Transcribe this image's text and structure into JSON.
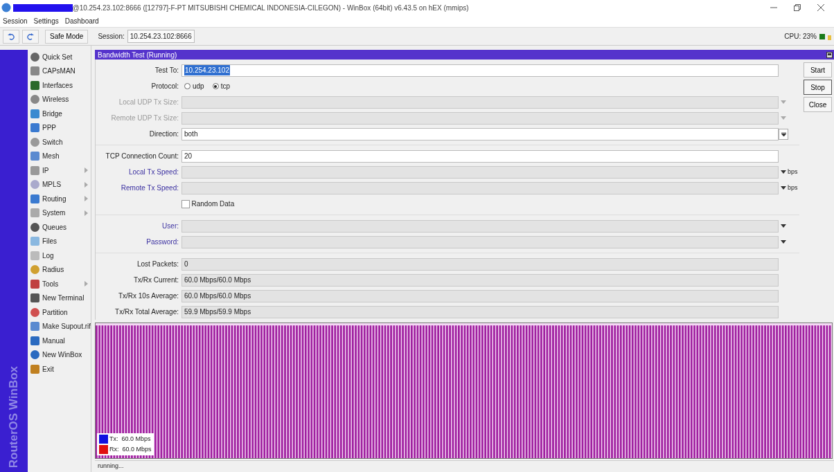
{
  "window": {
    "title": "@10.254.23.102:8666 ([12797]-F-PT MITSUBISHI CHEMICAL INDONESIA-CILEGON) - WinBox (64bit) v6.43.5 on hEX (mmips)",
    "redacted": true
  },
  "menu": [
    "Session",
    "Settings",
    "Dashboard"
  ],
  "toolbar": {
    "safe_mode": "Safe Mode",
    "session_label": "Session:",
    "session_value": "10.254.23.102:8666",
    "cpu": "CPU: 23%"
  },
  "sidebar": {
    "brand": "RouterOS WinBox",
    "items": [
      {
        "label": "Quick Set",
        "submenu": false
      },
      {
        "label": "CAPsMAN",
        "submenu": false
      },
      {
        "label": "Interfaces",
        "submenu": false
      },
      {
        "label": "Wireless",
        "submenu": false
      },
      {
        "label": "Bridge",
        "submenu": false
      },
      {
        "label": "PPP",
        "submenu": false
      },
      {
        "label": "Switch",
        "submenu": false
      },
      {
        "label": "Mesh",
        "submenu": false
      },
      {
        "label": "IP",
        "submenu": true
      },
      {
        "label": "MPLS",
        "submenu": true
      },
      {
        "label": "Routing",
        "submenu": true
      },
      {
        "label": "System",
        "submenu": true
      },
      {
        "label": "Queues",
        "submenu": false
      },
      {
        "label": "Files",
        "submenu": false
      },
      {
        "label": "Log",
        "submenu": false
      },
      {
        "label": "Radius",
        "submenu": false
      },
      {
        "label": "Tools",
        "submenu": true
      },
      {
        "label": "New Terminal",
        "submenu": false
      },
      {
        "label": "Partition",
        "submenu": false
      },
      {
        "label": "Make Supout.rif",
        "submenu": false
      },
      {
        "label": "Manual",
        "submenu": false
      },
      {
        "label": "New WinBox",
        "submenu": false
      },
      {
        "label": "Exit",
        "submenu": false
      }
    ]
  },
  "dialog": {
    "title": "Bandwidth Test (Running)",
    "rows": [
      {
        "kind": "text",
        "label": "Test To:",
        "value": "10.254.23.102",
        "highlighted": true,
        "disabled": false,
        "readonly": false,
        "emphasis": false
      },
      {
        "kind": "radio",
        "label": "Protocol:",
        "options": [
          {
            "label": "udp",
            "selected": false
          },
          {
            "label": "tcp",
            "selected": true
          }
        ]
      },
      {
        "kind": "text",
        "label": "Local UDP Tx Size:",
        "disabled": true,
        "readonly": true,
        "emphasis": false,
        "dropdown": true
      },
      {
        "kind": "text",
        "label": "Remote UDP Tx Size:",
        "disabled": true,
        "readonly": true,
        "emphasis": false,
        "dropdown": true
      },
      {
        "kind": "text",
        "label": "Direction:",
        "value": "both",
        "disabled": false,
        "readonly": false,
        "emphasis": false,
        "dropdown": true,
        "boxed": true
      },
      {
        "kind": "separator"
      },
      {
        "kind": "text",
        "label": "TCP Connection Count:",
        "value": "20",
        "disabled": false,
        "readonly": false,
        "emphasis": false
      },
      {
        "kind": "text",
        "label": "Local Tx Speed:",
        "disabled": false,
        "readonly": true,
        "emphasis": true,
        "dropdown": true,
        "unit": "bps"
      },
      {
        "kind": "text",
        "label": "Remote Tx Speed:",
        "disabled": false,
        "readonly": true,
        "emphasis": true,
        "dropdown": true,
        "unit": "bps"
      },
      {
        "kind": "checkbox",
        "label": "Random Data",
        "checked": false
      },
      {
        "kind": "separator"
      },
      {
        "kind": "text",
        "label": "User:",
        "disabled": false,
        "readonly": true,
        "emphasis": true,
        "dropdown": true
      },
      {
        "kind": "text",
        "label": "Password:",
        "disabled": false,
        "readonly": true,
        "emphasis": true,
        "dropdown": true
      },
      {
        "kind": "separator"
      },
      {
        "kind": "text",
        "label": "Lost Packets:",
        "value": "0",
        "disabled": false,
        "readonly": true,
        "emphasis": false
      },
      {
        "kind": "text",
        "label": "Tx/Rx Current:",
        "value": "60.0 Mbps/60.0 Mbps",
        "disabled": false,
        "readonly": true,
        "emphasis": false
      },
      {
        "kind": "text",
        "label": "Tx/Rx 10s Average:",
        "value": "60.0 Mbps/60.0 Mbps",
        "disabled": false,
        "readonly": true,
        "emphasis": false
      },
      {
        "kind": "text",
        "label": "Tx/Rx Total Average:",
        "value": "59.9 Mbps/59.9 Mbps",
        "disabled": false,
        "readonly": true,
        "emphasis": false
      }
    ],
    "buttons": [
      {
        "label": "Start",
        "default": false
      },
      {
        "label": "Stop",
        "default": true
      },
      {
        "label": "Close",
        "default": false
      }
    ],
    "graph": {
      "legend": [
        {
          "label": "Tx:  60.0 Mbps",
          "color": "#1010e0"
        },
        {
          "label": "Rx:  60.0 Mbps",
          "color": "#e01010"
        }
      ]
    },
    "status": "running..."
  }
}
